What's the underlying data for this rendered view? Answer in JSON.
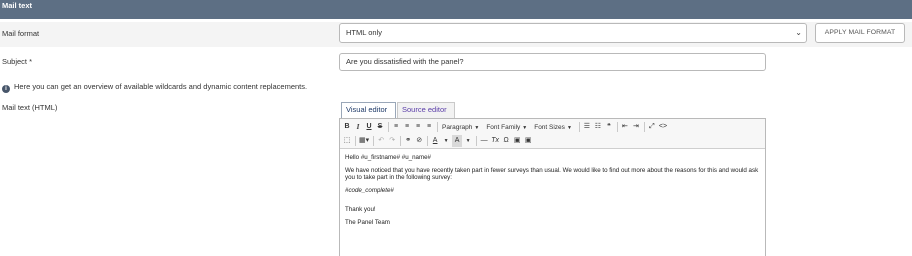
{
  "section": {
    "title": "Mail text"
  },
  "mail_format": {
    "label": "Mail format",
    "selected": "HTML only",
    "apply_button": "APPLY MAIL FORMAT"
  },
  "subject": {
    "label": "Subject *",
    "value": "Are you dissatisfied with the panel?"
  },
  "info": {
    "text": "Here you can get an overview of available wildcards and dynamic content replacements."
  },
  "mail_text": {
    "label": "Mail text (HTML)"
  },
  "tabs": [
    {
      "label": "Visual editor"
    },
    {
      "label": "Source editor"
    }
  ],
  "toolbar": {
    "bold": "B",
    "italic": "I",
    "underline": "U",
    "strike": "S",
    "paragraph": "Paragraph",
    "font_family": "Font Family",
    "font_sizes": "Font Sizes",
    "undo": "↶",
    "redo": "↷",
    "font_color": "A",
    "bg_color": "A",
    "clear_format": "Tx",
    "omega": "Ω",
    "quote": "❝",
    "code": "<>"
  },
  "content": {
    "greeting": "Hello #u_firstname# #u_name#",
    "body": "We have noticed that you have recently taken part in fewer surveys than usual. We would like to find out more about the reasons for this and would ask you to take part in the following survey:",
    "wildcard": "#code_complete#",
    "thanks": "Thank you!",
    "signature": "The Panel Team"
  }
}
